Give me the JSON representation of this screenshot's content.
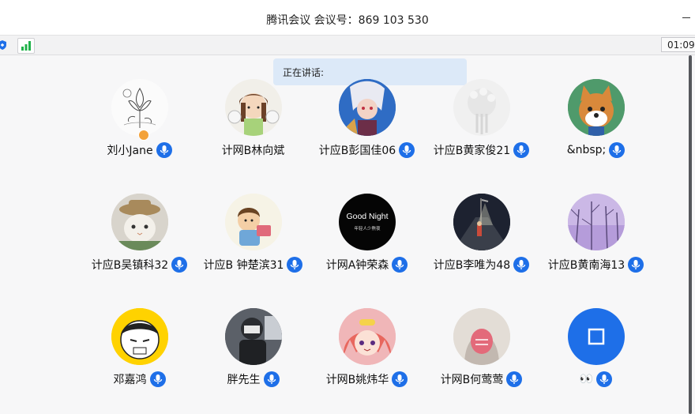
{
  "window": {
    "title": "腾讯会议 会议号：869 103 530",
    "timer": "01:09:"
  },
  "banner": {
    "speaking_label": "正在讲话:"
  },
  "participants": [
    {
      "name": "刘小Jane",
      "avatar": "lotus-ink-drawing",
      "mic": "mic-icon",
      "is_host": true
    },
    {
      "name": "计网B林向斌",
      "avatar": "anime-girl-with-cats",
      "mic": "",
      "is_host": false
    },
    {
      "name": "计应B彭国佳06",
      "avatar": "game-character",
      "mic": "mic-icon",
      "is_host": false
    },
    {
      "name": "计应B黄家俊21",
      "avatar": "white-sculpture",
      "mic": "mic-icon",
      "is_host": false
    },
    {
      "name": "&nbsp;",
      "avatar": "shiba-dog",
      "mic": "mic-icon",
      "is_host": false
    },
    {
      "name": "计应B吴镇科32",
      "avatar": "cat-with-hat",
      "mic": "mic-icon",
      "is_host": false
    },
    {
      "name": "计应B 钟楚滨31",
      "avatar": "cartoon-boy",
      "mic": "mic-icon",
      "is_host": false
    },
    {
      "name": "计网A钟荣森",
      "avatar": "good-night-text",
      "avatar_text": "Good Night",
      "avatar_subtext": "年轻人少熬夜",
      "mic": "mic-icon",
      "is_host": false
    },
    {
      "name": "计应B李唯为48",
      "avatar": "night-street",
      "mic": "mic-icon",
      "is_host": false
    },
    {
      "name": "计应B黄南海13",
      "avatar": "purple-trees",
      "mic": "mic-icon",
      "is_host": false
    },
    {
      "name": "邓嘉鸿",
      "avatar": "manga-face-yellow",
      "mic": "mic-icon",
      "is_host": false
    },
    {
      "name": "胖先生",
      "avatar": "person-photo-dark",
      "mic": "mic-icon",
      "is_host": false
    },
    {
      "name": "计网B姚炜华",
      "avatar": "anime-pink-hair",
      "mic": "mic-icon",
      "is_host": false
    },
    {
      "name": "计网B何莺莺",
      "avatar": "hooded-figure",
      "mic": "mic-icon",
      "is_host": false
    },
    {
      "name": "👀",
      "avatar": "blue-square-default",
      "mic": "mic-icon",
      "is_host": false
    }
  ],
  "colors": {
    "accent": "#1e6fe8",
    "banner_bg": "#dce9f8",
    "host_badge": "#f3a23a",
    "signal": "#20b24a"
  }
}
